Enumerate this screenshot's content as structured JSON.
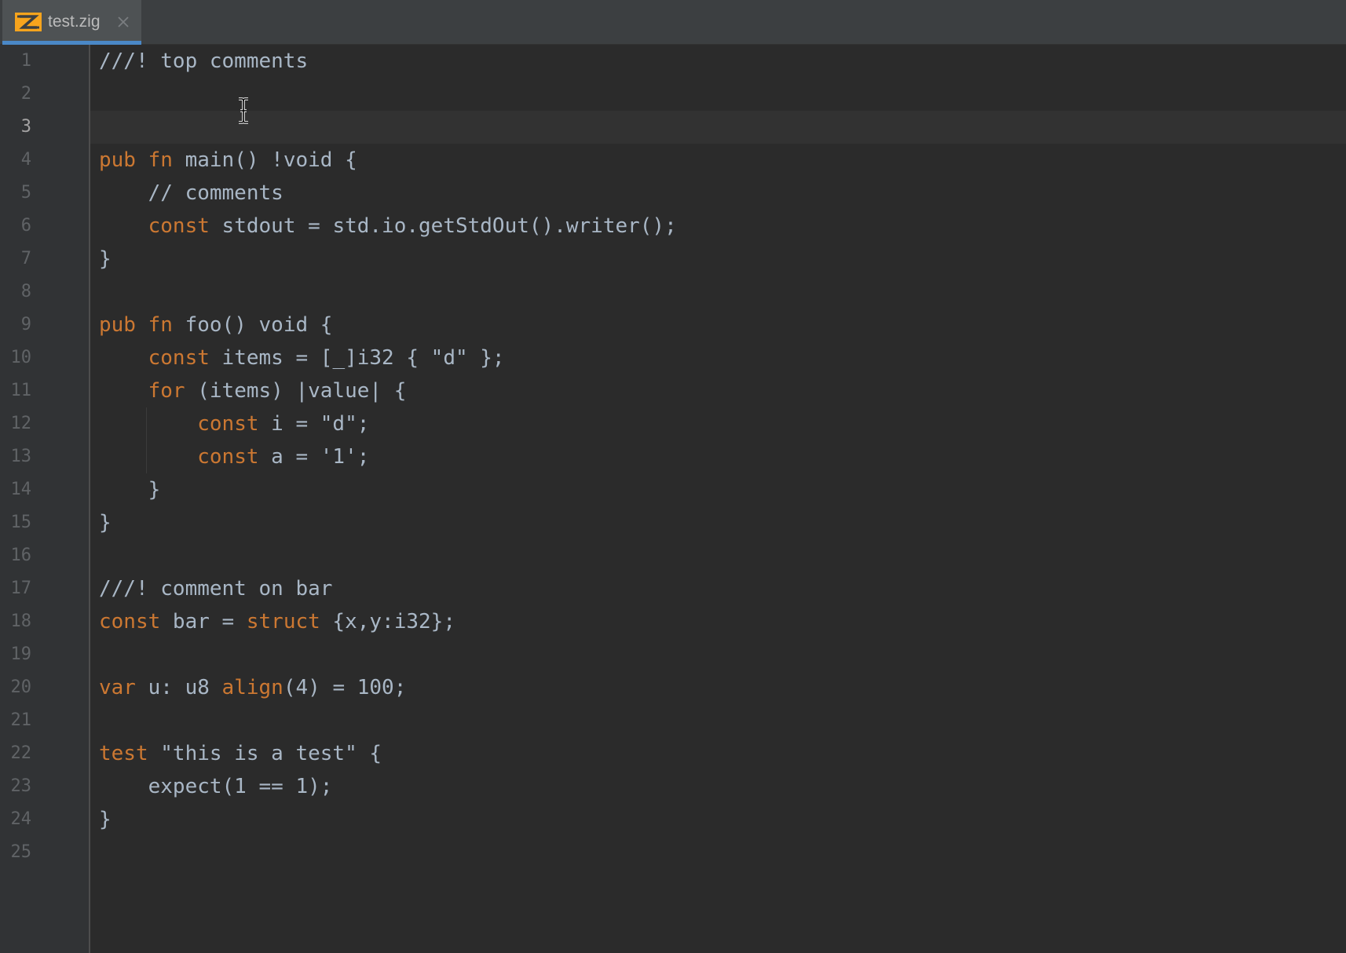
{
  "tab": {
    "title": "test.zig",
    "icon": "zig-file-icon",
    "close_icon": "close-icon"
  },
  "current_line": 3,
  "colors": {
    "keyword": "#cc7832",
    "text": "#a9b7c6",
    "background": "#2b2b2b",
    "gutter": "#313335",
    "tab_underline": "#4a88c7"
  },
  "lines": [
    {
      "n": "1",
      "tokens": [
        {
          "t": "///! top comments",
          "c": "cm"
        }
      ]
    },
    {
      "n": "2",
      "tokens": []
    },
    {
      "n": "3",
      "tokens": []
    },
    {
      "n": "4",
      "tokens": [
        {
          "t": "pub",
          "c": "kw"
        },
        {
          "t": " "
        },
        {
          "t": "fn",
          "c": "kw"
        },
        {
          "t": " main() !void {"
        }
      ]
    },
    {
      "n": "5",
      "tokens": [
        {
          "t": "    // comments",
          "c": "cm"
        }
      ]
    },
    {
      "n": "6",
      "tokens": [
        {
          "t": "    "
        },
        {
          "t": "const",
          "c": "kw"
        },
        {
          "t": " stdout = std.io.getStdOut().writer();"
        }
      ]
    },
    {
      "n": "7",
      "tokens": [
        {
          "t": "}"
        }
      ]
    },
    {
      "n": "8",
      "tokens": []
    },
    {
      "n": "9",
      "tokens": [
        {
          "t": "pub",
          "c": "kw"
        },
        {
          "t": " "
        },
        {
          "t": "fn",
          "c": "kw"
        },
        {
          "t": " foo() void {"
        }
      ]
    },
    {
      "n": "10",
      "tokens": [
        {
          "t": "    "
        },
        {
          "t": "const",
          "c": "kw"
        },
        {
          "t": " items = [_]i32 { \"d\" };"
        }
      ]
    },
    {
      "n": "11",
      "tokens": [
        {
          "t": "    "
        },
        {
          "t": "for",
          "c": "kw"
        },
        {
          "t": " (items) |value| {"
        }
      ]
    },
    {
      "n": "12",
      "tokens": [
        {
          "t": "        "
        },
        {
          "t": "const",
          "c": "kw"
        },
        {
          "t": " i = \"d\";"
        }
      ]
    },
    {
      "n": "13",
      "tokens": [
        {
          "t": "        "
        },
        {
          "t": "const",
          "c": "kw"
        },
        {
          "t": " a = '1';"
        }
      ]
    },
    {
      "n": "14",
      "tokens": [
        {
          "t": "    }"
        }
      ]
    },
    {
      "n": "15",
      "tokens": [
        {
          "t": "}"
        }
      ]
    },
    {
      "n": "16",
      "tokens": []
    },
    {
      "n": "17",
      "tokens": [
        {
          "t": "///! comment on bar",
          "c": "cm"
        }
      ]
    },
    {
      "n": "18",
      "tokens": [
        {
          "t": "const",
          "c": "kw"
        },
        {
          "t": " bar = "
        },
        {
          "t": "struct",
          "c": "kw"
        },
        {
          "t": " {x,y:i32};"
        }
      ]
    },
    {
      "n": "19",
      "tokens": []
    },
    {
      "n": "20",
      "tokens": [
        {
          "t": "var",
          "c": "kw"
        },
        {
          "t": " u: u8 "
        },
        {
          "t": "align",
          "c": "kw"
        },
        {
          "t": "(4) = 100;"
        }
      ]
    },
    {
      "n": "21",
      "tokens": []
    },
    {
      "n": "22",
      "tokens": [
        {
          "t": "test",
          "c": "kw"
        },
        {
          "t": " \"this is a test\" {"
        }
      ]
    },
    {
      "n": "23",
      "tokens": [
        {
          "t": "    expect(1 == 1);"
        }
      ]
    },
    {
      "n": "24",
      "tokens": [
        {
          "t": "}"
        }
      ]
    },
    {
      "n": "25",
      "tokens": []
    }
  ]
}
